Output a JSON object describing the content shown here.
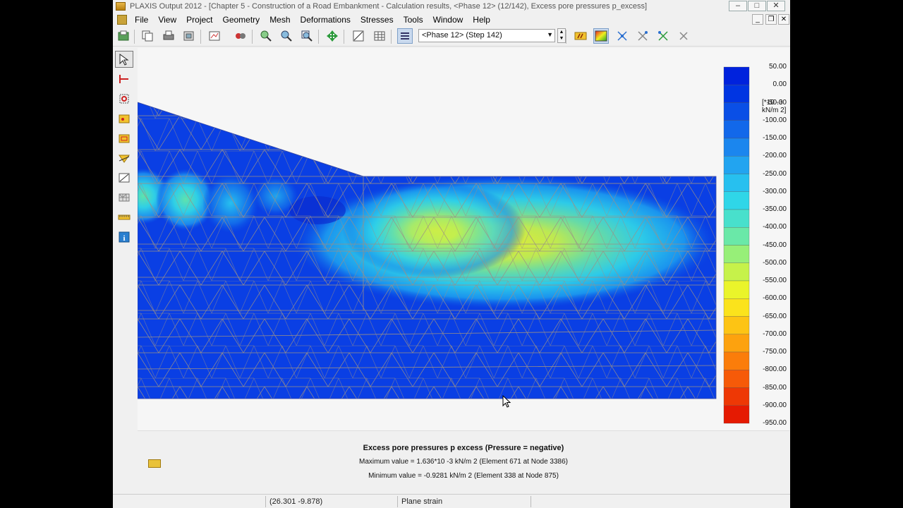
{
  "window": {
    "title": "PLAXIS Output 2012 - [Chapter 5 - Construction of a Road Embankment - Calculation results, <Phase 12> (12/142), Excess pore pressures p_excess]"
  },
  "menu": [
    "File",
    "View",
    "Project",
    "Geometry",
    "Mesh",
    "Deformations",
    "Stresses",
    "Tools",
    "Window",
    "Help"
  ],
  "toolbar": {
    "phase_selected": "<Phase 12> (Step 142)"
  },
  "legend": {
    "unit": "[*10 -3 kN/m 2]",
    "labels": [
      "50.00",
      "0.00",
      "-50.00",
      "-100.00",
      "-150.00",
      "-200.00",
      "-250.00",
      "-300.00",
      "-350.00",
      "-400.00",
      "-450.00",
      "-500.00",
      "-550.00",
      "-600.00",
      "-650.00",
      "-700.00",
      "-750.00",
      "-800.00",
      "-850.00",
      "-900.00",
      "-950.00"
    ],
    "colors": [
      "#0022dd",
      "#0035e2",
      "#0a4fe6",
      "#1268ea",
      "#1b86ee",
      "#22a4f0",
      "#27c0ef",
      "#2fd6e8",
      "#48e0cc",
      "#6ae8a8",
      "#97ef78",
      "#c6f24a",
      "#eaf42a",
      "#fbe31c",
      "#fdc414",
      "#fda20e",
      "#fb7d0a",
      "#f65a08",
      "#ee3805",
      "#e51a02"
    ]
  },
  "info": {
    "title": "Excess pore pressures p excess (Pressure = negative)",
    "max_text": "Maximum value = 1.636*10 -3 kN/m 2 (Element 671 at Node 3386)",
    "min_text": "Minimum value = -0.9281 kN/m 2 (Element 338 at Node 875)"
  },
  "status": {
    "coords": "(26.301 -9.878)",
    "mode": "Plane strain"
  }
}
